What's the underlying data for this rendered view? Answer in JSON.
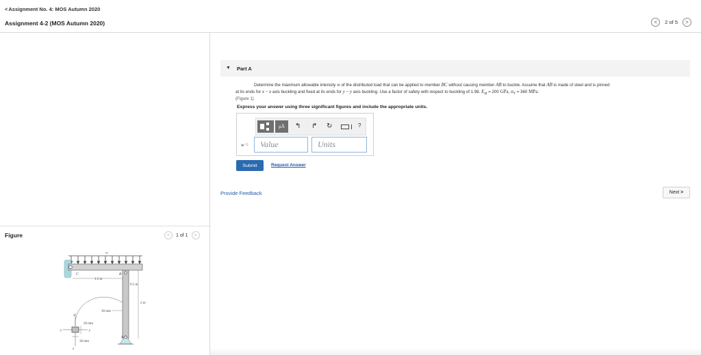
{
  "header": {
    "back_chevron": "<",
    "back_label": "Assignment No. 4: MOS Autumn 2020",
    "title": "Assignment 4-2 (MOS Autumn 2020)",
    "pager": {
      "prev": "<",
      "text": "2 of 5",
      "next": ">"
    }
  },
  "figure": {
    "label": "Figure",
    "pager": {
      "prev": "<",
      "text": "1 of 1",
      "next": ">"
    },
    "labels": {
      "w": "w",
      "c": "C",
      "b": "B",
      "a": "A",
      "dim_15": "1.5 m",
      "dim_05": "0.5 m",
      "dim_2": "2 m",
      "dim_30a": "30 mm",
      "dim_20": "20 mm",
      "dim_30b": "30 mm",
      "axis_y": "y",
      "axis_x": "x",
      "axis_x2": "x",
      "axis_y2": "y"
    }
  },
  "part": {
    "caret": "▼",
    "label": "Part A",
    "problem": {
      "t1": "Determine the maximum allowable intensity ",
      "v_w": "w",
      "t2": " of the distributed load that can be applied to member ",
      "v_bc": "BC",
      "t3": " without causing member ",
      "v_ab": "AB",
      "t4": " to buckle. Assume that ",
      "v_ab2": "AB",
      "t5": " is made of steel and is pinned",
      "l2a": "at its ends for ",
      "v_x1": "x",
      "l2b": " − ",
      "v_x2": "x",
      "l2c": " axis buckling and fixed at its ends for ",
      "v_y1": "y",
      "l2d": " − ",
      "v_y2": "y",
      "l2e": " axis buckling. Use a factor of safety with respect to buckling of 1.98. ",
      "v_est": "E",
      "v_est_sub": "st",
      "l2f": " = 200 ",
      "v_gpa": "GPa",
      "l2g": ", ",
      "v_sig": "σ",
      "v_sig_sub": "Y",
      "l2h": " = 360 ",
      "v_mpa": "MPa",
      "l2i": ".",
      "figref": "(Figure 1)"
    },
    "instructions": "Express your answer using three significant figures and include the appropriate units.",
    "toolbar": {
      "mu_label": "μÅ",
      "undo": "↰",
      "redo": "↱",
      "reset": "↻",
      "help": "?"
    },
    "answer": {
      "var_label": "w =",
      "value_placeholder": "Value",
      "units_placeholder": "Units"
    },
    "submit_label": "Submit",
    "request_label": "Request Answer"
  },
  "footer": {
    "feedback_label": "Provide Feedback",
    "next_label": "Next",
    "next_chevron": ">"
  }
}
